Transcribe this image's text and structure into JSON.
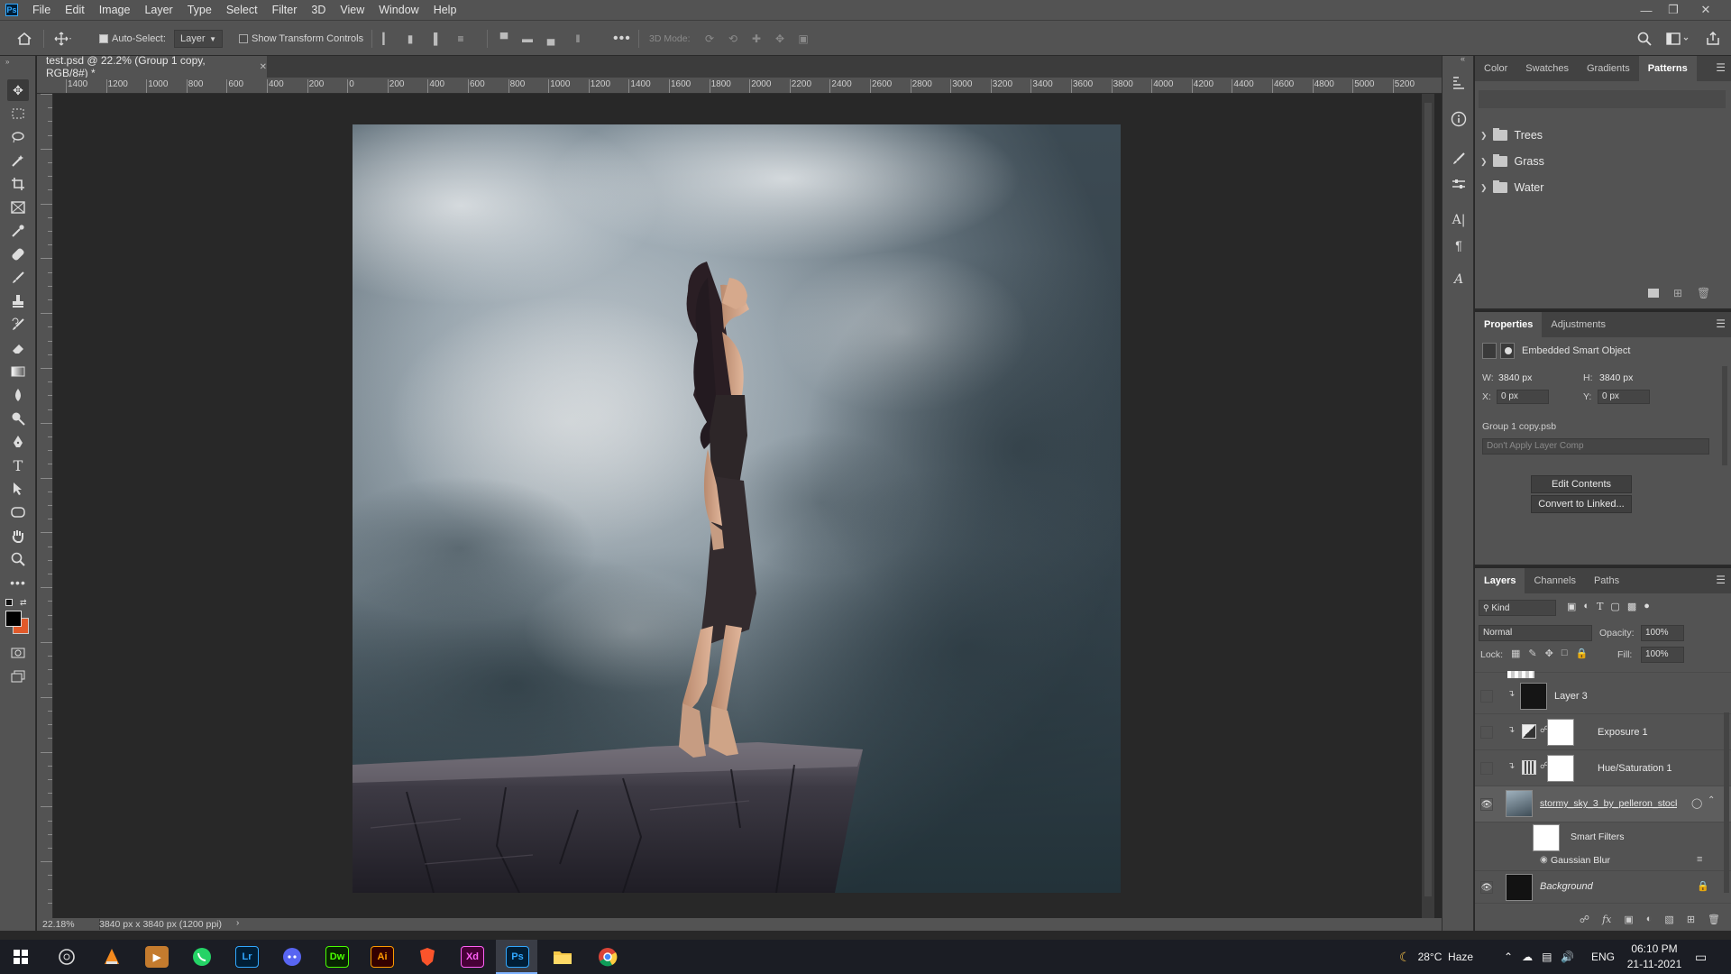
{
  "app": {
    "logo_text": "Ps",
    "menu": [
      "File",
      "Edit",
      "Image",
      "Layer",
      "Type",
      "Select",
      "Filter",
      "3D",
      "View",
      "Window",
      "Help"
    ]
  },
  "options_bar": {
    "auto_select_label": "Auto-Select:",
    "auto_select_target": "Layer",
    "show_transform_label": "Show Transform Controls",
    "mode_3d_label": "3D Mode:"
  },
  "document": {
    "tab_title": "test.psd @ 22.2% (Group 1 copy, RGB/8#) *",
    "ruler_top_ticks": [
      "1400",
      "1200",
      "1000",
      "800",
      "600",
      "400",
      "200",
      "0",
      "200",
      "400",
      "600",
      "800",
      "1000",
      "1200",
      "1400",
      "1600",
      "1800",
      "2000",
      "2200",
      "2400",
      "2600",
      "2800",
      "3000",
      "3200",
      "3400",
      "3600",
      "3800",
      "4000",
      "4200",
      "4400",
      "4600",
      "4800",
      "5000",
      "5200"
    ],
    "zoom": "22.18%",
    "doc_size": "3840 px x 3840 px (1200 ppi)"
  },
  "patterns_panel": {
    "tabs": [
      "Color",
      "Swatches",
      "Gradients",
      "Patterns"
    ],
    "active_tab": "Patterns",
    "groups": [
      "Trees",
      "Grass",
      "Water"
    ]
  },
  "properties_panel": {
    "tabs": [
      "Properties",
      "Adjustments"
    ],
    "active_tab": "Properties",
    "type_label": "Embedded Smart Object",
    "w_label": "W:",
    "w_value": "3840 px",
    "h_label": "H:",
    "h_value": "3840 px",
    "x_label": "X:",
    "x_value": "0 px",
    "y_label": "Y:",
    "y_value": "0 px",
    "file_name": "Group 1 copy.psb",
    "layer_comp": "Don't Apply Layer Comp",
    "edit_contents_label": "Edit Contents",
    "convert_label": "Convert to Linked..."
  },
  "layers_panel": {
    "tabs": [
      "Layers",
      "Channels",
      "Paths"
    ],
    "active_tab": "Layers",
    "filter_kind": "Kind",
    "blend_mode": "Normal",
    "opacity_label": "Opacity:",
    "opacity_value": "100%",
    "lock_label": "Lock:",
    "fill_label": "Fill:",
    "fill_value": "100%",
    "layers": [
      {
        "name": "Layer 3",
        "visible": false
      },
      {
        "name": "Exposure 1",
        "visible": false
      },
      {
        "name": "Hue/Saturation 1",
        "visible": false
      },
      {
        "name": "stormy_sky_3_by_pelleron_stock...",
        "visible": true
      },
      {
        "name": "Smart Filters",
        "visible": true
      },
      {
        "name": "Gaussian Blur",
        "visible": true
      },
      {
        "name": "Background",
        "visible": true
      }
    ]
  },
  "taskbar": {
    "apps": [
      "Lr",
      "Dw",
      "Ai",
      "Xd",
      "Ps"
    ],
    "weather": "28°C  Haze",
    "language": "ENG",
    "time": "06:10 PM",
    "date": "21-11-2021"
  }
}
